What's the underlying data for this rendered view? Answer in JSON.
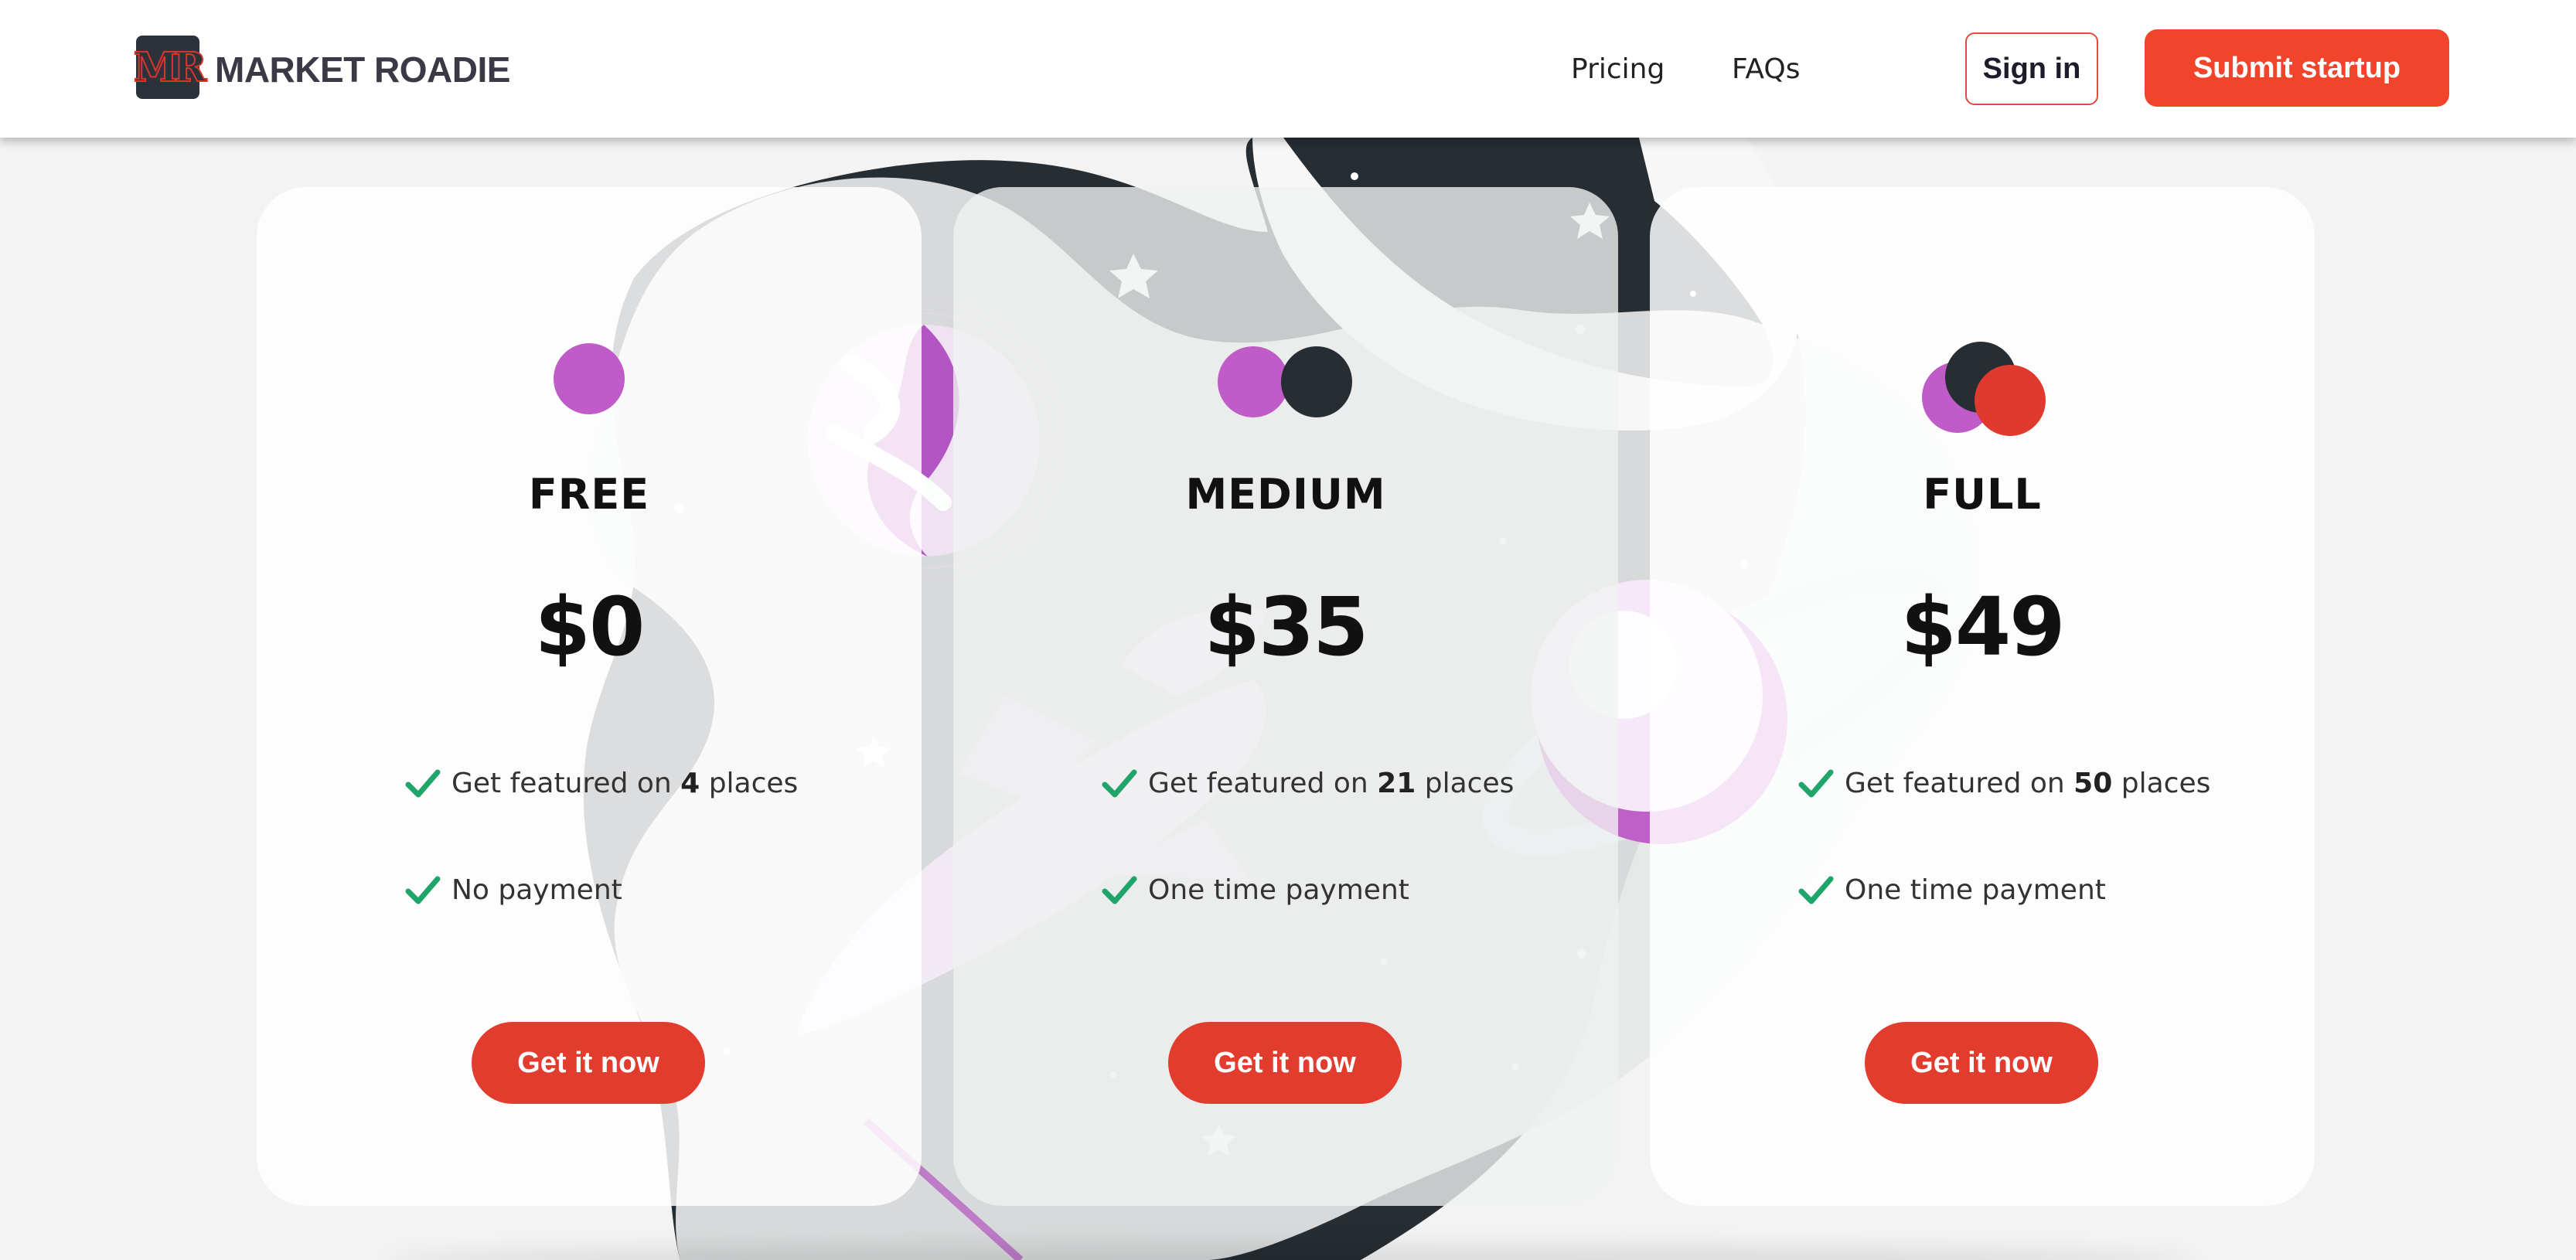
{
  "header": {
    "logo_letters": "MR",
    "brand": "MARKET ROADIE",
    "nav": [
      "Pricing",
      "FAQs"
    ],
    "sign_in": "Sign in",
    "submit": "Submit startup"
  },
  "colors": {
    "accent": "#f2442a",
    "cta": "#e23c2e",
    "purple": "#bf5cc7",
    "dark": "#262d33",
    "red": "#e0392d",
    "check": "#1fa46a"
  },
  "plans": [
    {
      "name": "FREE",
      "price": "$0",
      "features": [
        {
          "pre": "Get featured on ",
          "num": "4",
          "post": " places"
        },
        {
          "pre": "No payment",
          "num": "",
          "post": ""
        }
      ],
      "cta": "Get it now",
      "dot_colors": [
        "#bf5cc7"
      ]
    },
    {
      "name": "MEDIUM",
      "price": "$35",
      "features": [
        {
          "pre": "Get featured on ",
          "num": "21",
          "post": " places"
        },
        {
          "pre": "One time payment",
          "num": "",
          "post": ""
        }
      ],
      "cta": "Get it now",
      "dot_colors": [
        "#bf5cc7",
        "#262d33"
      ]
    },
    {
      "name": "FULL",
      "price": "$49",
      "features": [
        {
          "pre": "Get featured on ",
          "num": "50",
          "post": " places"
        },
        {
          "pre": "One time payment",
          "num": "",
          "post": ""
        }
      ],
      "cta": "Get it now",
      "dot_colors": [
        "#bf5cc7",
        "#262d33",
        "#e0392d"
      ]
    }
  ]
}
